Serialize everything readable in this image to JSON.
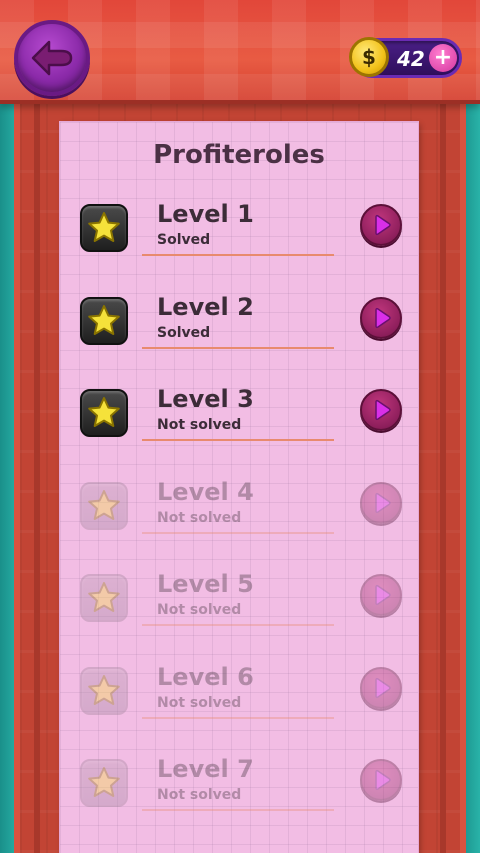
{
  "coins": {
    "count": "42",
    "symbol": "$",
    "plus": "+"
  },
  "paper": {
    "title": "Profiteroles"
  },
  "levels": [
    {
      "name": "Level 1",
      "status": "Solved",
      "locked": false
    },
    {
      "name": "Level 2",
      "status": "Solved",
      "locked": false
    },
    {
      "name": "Level 3",
      "status": "Not solved",
      "locked": false
    },
    {
      "name": "Level 4",
      "status": "Not solved",
      "locked": true
    },
    {
      "name": "Level 5",
      "status": "Not solved",
      "locked": true
    },
    {
      "name": "Level 6",
      "status": "Not solved",
      "locked": true
    },
    {
      "name": "Level 7",
      "status": "Not solved",
      "locked": true
    }
  ],
  "icons": {
    "back": "back-arrow-icon",
    "coin": "coin-icon",
    "star": "star-icon",
    "play": "play-icon"
  },
  "colors": {
    "accent_purple": "#8b2aa9",
    "paper_pink": "#f2bde4",
    "frame_red": "#c24434",
    "star_yellow": "#f5e23a",
    "play_magenta": "#d92fe8"
  }
}
